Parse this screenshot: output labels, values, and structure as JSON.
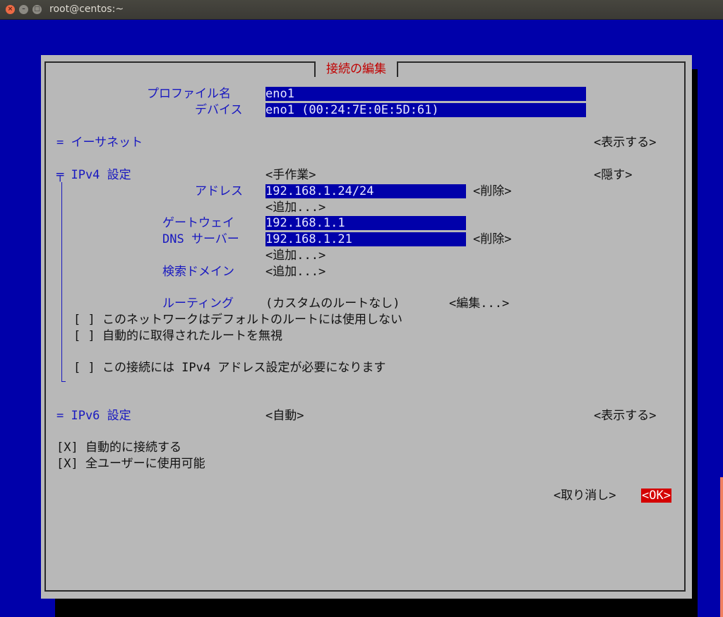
{
  "window": {
    "title": "root@centos:~"
  },
  "dialog": {
    "title": "接続の編集",
    "profile_label": "プロファイル名",
    "profile_value": "eno1",
    "device_label": "デバイス",
    "device_value": "eno1 (00:24:7E:0E:5D:61)",
    "ethernet": {
      "label": "= イーサネット",
      "toggle": "<表示する>"
    },
    "ipv4": {
      "label": "╤ IPv4 設定",
      "mode": "<手作業>",
      "toggle": "<隠す>",
      "address_label": "アドレス",
      "address_value": "192.168.1.24/24",
      "address_remove": "<削除>",
      "address_add": "<追加...>",
      "gateway_label": "ゲートウェイ",
      "gateway_value": "192.168.1.1",
      "dns_label": "DNS サーバー",
      "dns_value": "192.168.1.21",
      "dns_remove": "<削除>",
      "dns_add": "<追加...>",
      "search_label": "検索ドメイン",
      "search_add": "<追加...>",
      "routing_label": "ルーティング",
      "routing_value": "(カスタムのルートなし)",
      "routing_edit": "<編集...>",
      "check_never_default": "[ ] このネットワークはデフォルトのルートには使用しない",
      "check_ignore_routes": "[ ] 自動的に取得されたルートを無視",
      "check_require_ipv4": "[ ] この接続には IPv4 アドレス設定が必要になります"
    },
    "ipv6": {
      "label": "= IPv6 設定",
      "mode": "<自動>",
      "toggle": "<表示する>"
    },
    "check_autoconnect": "[X] 自動的に接続する",
    "check_all_users": "[X] 全ユーザーに使用可能",
    "cancel_button": "<取り消し>",
    "ok_button": "<OK>"
  },
  "colors": {
    "terminal_bg": "#0000aa",
    "dialog_bg": "#b8b8b8",
    "label_blue": "#1818c0",
    "field_bg": "#0000aa",
    "ok_bg": "#d40000",
    "title_red": "#c00000"
  }
}
